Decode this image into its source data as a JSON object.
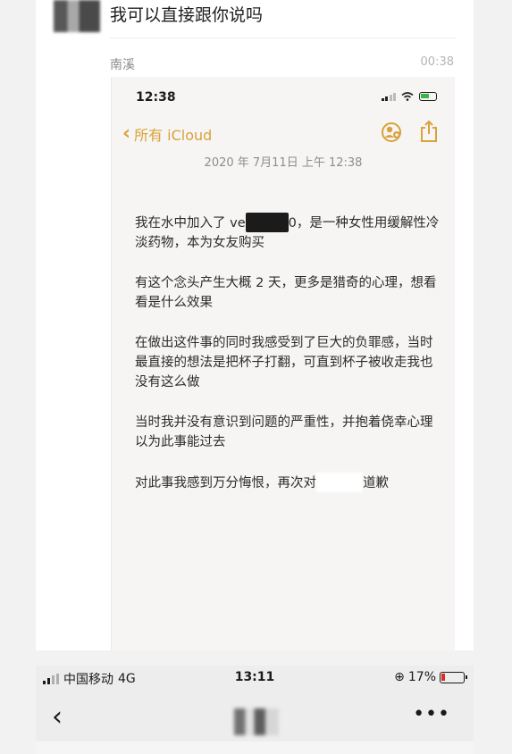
{
  "chat": {
    "top_message": "我可以直接跟你说吗",
    "sender_name": "南溪",
    "send_time": "00:38"
  },
  "notes_screenshot": {
    "status_time": "12:38",
    "back_label": "所有 iCloud",
    "date": "2020 年 7月11日 上午 12:38",
    "paragraphs": {
      "p1_a": "我在水中加入了 ve",
      "p1_b": "0，是一种女性用缓解性冷淡药物，本为女友购买",
      "p2": "有这个念头产生大概 2 天，更多是猎奇的心理，想看看是什么效果",
      "p3": "在做出这件事的同时我感受到了巨大的负罪感，当时最直接的想法是把杯子打翻，可直到杯子被收走我也没有这么做",
      "p4": "当时我并没有意识到问题的严重性，并抱着侥幸心理以为此事能过去",
      "p5_a": "对此事我感到万分悔恨，再次对",
      "p5_b": "道歉"
    },
    "icons": [
      "signal-icon",
      "wifi-icon",
      "battery-icon",
      "chevron-left-icon",
      "collaborate-icon",
      "share-icon"
    ],
    "accent_color": "#d9a23a"
  },
  "phone_status": {
    "carrier": "中国移动",
    "network": "4G",
    "time": "13:11",
    "battery_percent": "17%",
    "battery_level": 0.17,
    "battery_color": "#e02929"
  },
  "nav": {
    "back_icon": "‹",
    "more_icon": "•••"
  }
}
